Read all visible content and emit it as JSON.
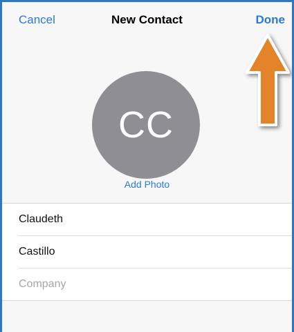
{
  "navbar": {
    "cancel_label": "Cancel",
    "title": "New Contact",
    "done_label": "Done"
  },
  "avatar": {
    "initials": "CC",
    "add_photo_label": "Add Photo"
  },
  "fields": {
    "first_name": "Claudeth",
    "last_name": "Castillo",
    "company_placeholder": "Company"
  },
  "colors": {
    "accent": "#2c79d8",
    "avatar_bg": "#8e8e93",
    "frame_border": "#2b78c5",
    "arrow_fill": "#e3842a"
  },
  "annotation": {
    "icon": "up-arrow-icon"
  }
}
